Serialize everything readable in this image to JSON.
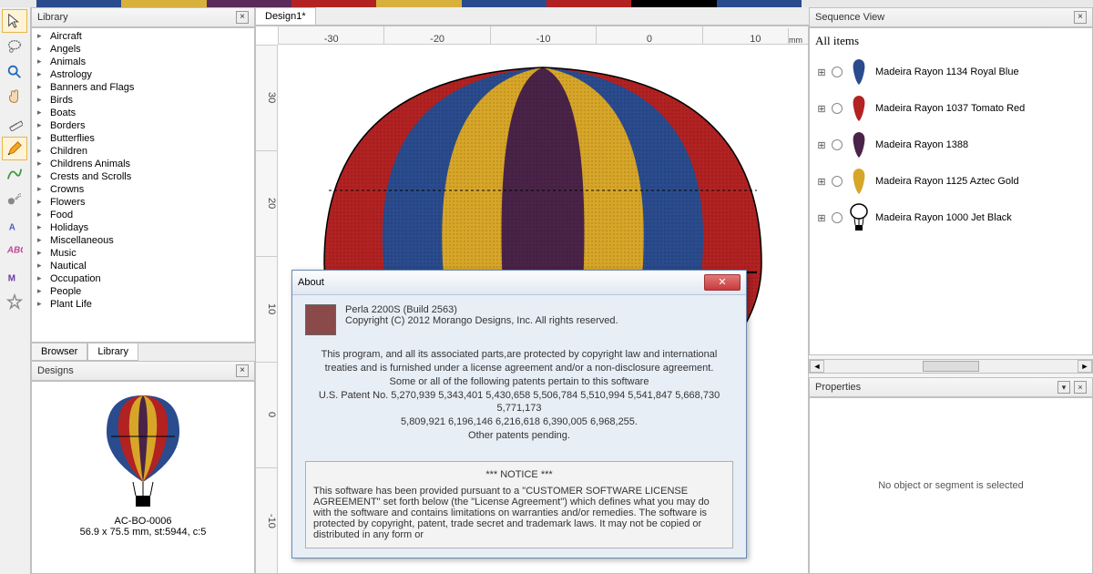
{
  "topColors": [
    "#2a4b8d",
    "#d7b13b",
    "#5a2a5a",
    "#b22222",
    "#d7b13b",
    "#2a4b8d",
    "#b22222",
    "#000000",
    "#2a4b8d"
  ],
  "library": {
    "title": "Library",
    "categories": [
      "Aircraft",
      "Angels",
      "Animals",
      "Astrology",
      "Banners and Flags",
      "Birds",
      "Boats",
      "Borders",
      "Butterflies",
      "Children",
      "Childrens Animals",
      "Crests and Scrolls",
      "Crowns",
      "Flowers",
      "Food",
      "Holidays",
      "Miscellaneous",
      "Music",
      "Nautical",
      "Occupation",
      "People",
      "Plant Life"
    ],
    "tabs": [
      "Browser",
      "Library"
    ],
    "activeTab": 1
  },
  "designs": {
    "title": "Designs",
    "thumbName": "AC-BO-0006",
    "thumbMeta": "56.9 x 75.5 mm, st:5944, c:5"
  },
  "docTab": "Design1*",
  "rulerH": [
    "-30",
    "-20",
    "-10",
    "0",
    "10"
  ],
  "rulerHUnit": "mm",
  "rulerV": [
    "30",
    "20",
    "10",
    "0",
    "-10"
  ],
  "sequence": {
    "title": "Sequence View",
    "heading": "All items",
    "items": [
      {
        "label": "Madeira Rayon 1134 Royal Blue",
        "color": "#2a4b8d"
      },
      {
        "label": "Madeira Rayon 1037 Tomato Red",
        "color": "#b22222"
      },
      {
        "label": "Madeira Rayon 1388",
        "color": "#4a2348"
      },
      {
        "label": "Madeira Rayon 1125 Aztec Gold",
        "color": "#d7a628"
      },
      {
        "label": "Madeira Rayon 1000 Jet Black",
        "color": "#000000"
      }
    ]
  },
  "properties": {
    "title": "Properties",
    "empty": "No object or segment is selected"
  },
  "about": {
    "title": "About",
    "product": "Perla 2200S (Build 2563)",
    "copyright": "Copyright (C) 2012 Morango Designs, Inc. All rights reserved.",
    "para1": "This program, and all its associated parts,are protected by copyright law and international treaties and is furnished under a license agreement and/or a non-disclosure agreement.",
    "para2": "Some or all of the following patents pertain to this software",
    "patents1": "U.S. Patent No. 5,270,939 5,343,401 5,430,658 5,506,784 5,510,994 5,541,847 5,668,730 5,771,173",
    "patents2": "5,809,921 6,196,146 6,216,618 6,390,005  6,968,255.",
    "pending": "Other patents pending.",
    "noticeHeader": "*** NOTICE ***",
    "noticeBody": "This software has been provided pursuant to a \"CUSTOMER SOFTWARE LICENSE AGREEMENT\" set forth below (the \"License Agreement\") which defines what you may do with the software and contains limitations on warranties and/or remedies. The software is protected by copyright, patent, trade secret and trademark laws.  It may not be copied or distributed in any form or"
  }
}
